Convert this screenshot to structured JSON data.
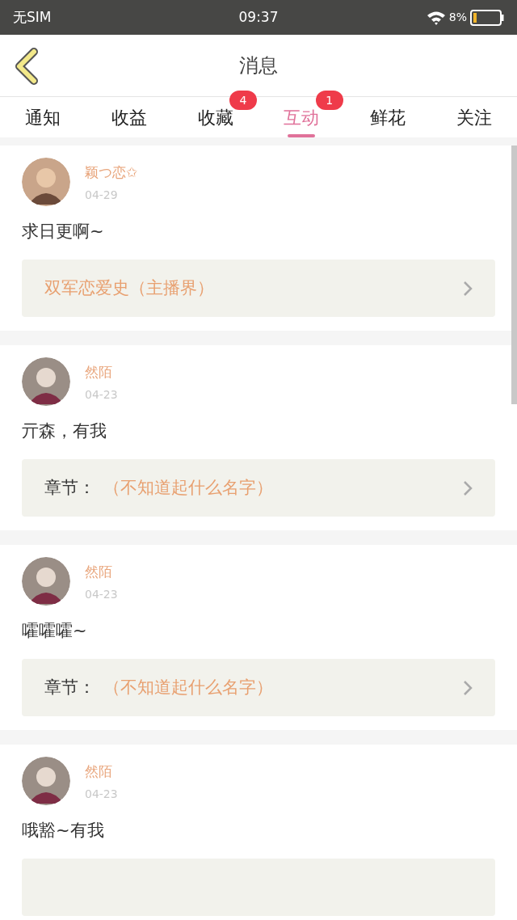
{
  "status_bar": {
    "carrier": "无SIM",
    "time": "09:37",
    "battery": "8%"
  },
  "header": {
    "title": "消息"
  },
  "tabs": [
    {
      "label": "通知",
      "selected": false
    },
    {
      "label": "收益",
      "selected": false
    },
    {
      "label": "收藏",
      "selected": false,
      "badge": "4"
    },
    {
      "label": "互动",
      "selected": true,
      "badge": "1"
    },
    {
      "label": "鲜花",
      "selected": false
    },
    {
      "label": "关注",
      "selected": false
    }
  ],
  "messages": [
    {
      "user": "颖つ恋✩",
      "date": "04-29",
      "text": "求日更啊~",
      "link": {
        "title": "双军恋爱史（主播界）"
      }
    },
    {
      "user": "然陌",
      "date": "04-23",
      "text": "亓森，有我",
      "link": {
        "label": "章节：",
        "title": "（不知道起什么名字）"
      }
    },
    {
      "user": "然陌",
      "date": "04-23",
      "text": "嚯嚯嚯~",
      "link": {
        "label": "章节：",
        "title": "（不知道起什么名字）"
      }
    },
    {
      "user": "然陌",
      "date": "04-23",
      "text": "哦豁~有我"
    }
  ]
}
